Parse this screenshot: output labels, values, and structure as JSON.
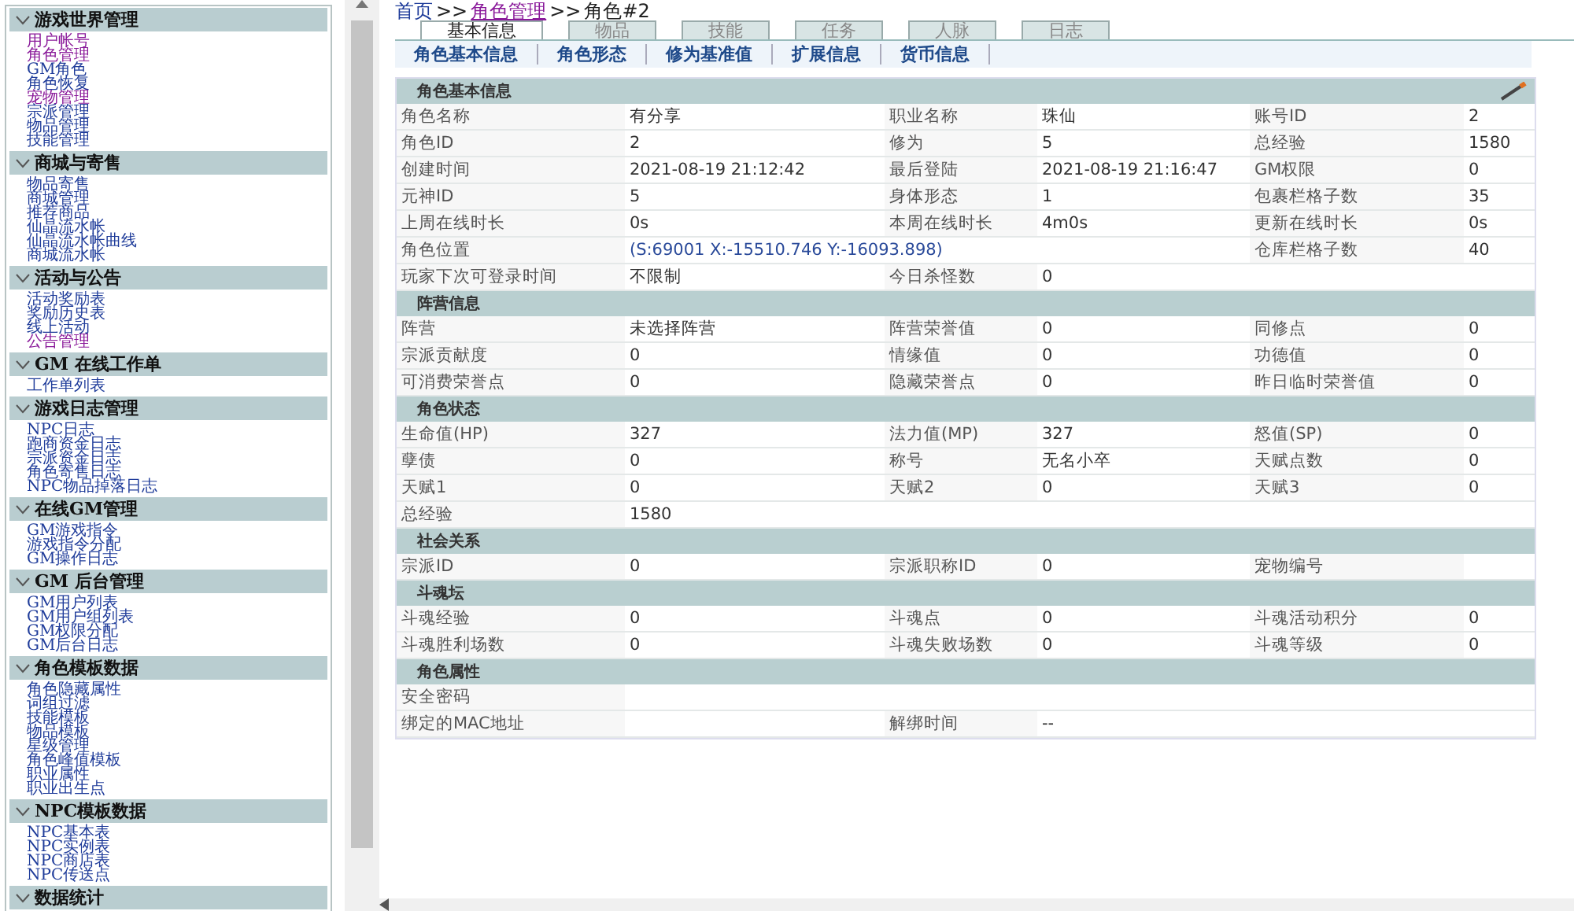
{
  "sidebar": {
    "sections": [
      {
        "title": "游戏世界管理",
        "items": [
          {
            "label": "用户帐号",
            "visited": true
          },
          {
            "label": "角色管理",
            "visited": true
          },
          {
            "label": "GM角色",
            "visited": false
          },
          {
            "label": "角色恢复",
            "visited": false
          },
          {
            "label": "宠物管理",
            "visited": true
          },
          {
            "label": "宗派管理",
            "visited": false
          },
          {
            "label": "物品管理",
            "visited": false
          },
          {
            "label": "技能管理",
            "visited": false
          }
        ]
      },
      {
        "title": "商城与寄售",
        "items": [
          {
            "label": "物品寄售",
            "visited": false
          },
          {
            "label": "商城管理",
            "visited": false
          },
          {
            "label": "推荐商品",
            "visited": false
          },
          {
            "label": "仙晶流水帐",
            "visited": false
          },
          {
            "label": "仙晶流水帐曲线",
            "visited": false
          },
          {
            "label": "商城流水帐",
            "visited": false
          }
        ]
      },
      {
        "title": "活动与公告",
        "items": [
          {
            "label": "活动奖励表",
            "visited": false
          },
          {
            "label": "奖励历史表",
            "visited": false
          },
          {
            "label": "线上活动",
            "visited": false
          },
          {
            "label": "公告管理",
            "visited": true
          }
        ]
      },
      {
        "title": "GM 在线工作单",
        "items": [
          {
            "label": "工作单列表",
            "visited": false
          }
        ]
      },
      {
        "title": "游戏日志管理",
        "items": [
          {
            "label": "NPC日志",
            "visited": false
          },
          {
            "label": "跑商资金日志",
            "visited": false
          },
          {
            "label": "宗派资金日志",
            "visited": false
          },
          {
            "label": "角色寄售日志",
            "visited": false
          },
          {
            "label": "NPC物品掉落日志",
            "visited": false
          }
        ]
      },
      {
        "title": "在线GM管理",
        "items": [
          {
            "label": "GM游戏指令",
            "visited": false
          },
          {
            "label": "游戏指令分配",
            "visited": false
          },
          {
            "label": "GM操作日志",
            "visited": false
          }
        ]
      },
      {
        "title": "GM 后台管理",
        "items": [
          {
            "label": "GM用户列表",
            "visited": false
          },
          {
            "label": "GM用户组列表",
            "visited": false
          },
          {
            "label": "GM权限分配",
            "visited": false
          },
          {
            "label": "GM后台日志",
            "visited": false
          }
        ]
      },
      {
        "title": "角色模板数据",
        "items": [
          {
            "label": "角色隐藏属性",
            "visited": false
          },
          {
            "label": "词组过滤",
            "visited": false
          },
          {
            "label": "技能模板",
            "visited": false
          },
          {
            "label": "物品模板",
            "visited": false
          },
          {
            "label": "星级管理",
            "visited": false
          },
          {
            "label": "角色峰值模板",
            "visited": false
          },
          {
            "label": "职业属性",
            "visited": false
          },
          {
            "label": "职业出生点",
            "visited": false
          }
        ]
      },
      {
        "title": "NPC模板数据",
        "items": [
          {
            "label": "NPC基本表",
            "visited": false
          },
          {
            "label": "NPC实例表",
            "visited": false
          },
          {
            "label": "NPC商店表",
            "visited": false
          },
          {
            "label": "NPC传送点",
            "visited": false
          }
        ]
      },
      {
        "title": "数据统计"
      }
    ]
  },
  "breadcrumb": [
    {
      "label": "首页",
      "kind": "link"
    },
    {
      "label": ">>",
      "kind": "sep"
    },
    {
      "label": "角色管理",
      "kind": "visited"
    },
    {
      "label": ">>",
      "kind": "sep"
    },
    {
      "label": "角色#2",
      "kind": "text"
    }
  ],
  "tabs": [
    {
      "label": "基本信息",
      "selected": true
    },
    {
      "label": "物品",
      "selected": false
    },
    {
      "label": "技能",
      "selected": false
    },
    {
      "label": "任务",
      "selected": false
    },
    {
      "label": "人脉",
      "selected": false
    },
    {
      "label": "日志",
      "selected": false
    }
  ],
  "subtabs": [
    "角色基本信息",
    "角色形态",
    "修为基准值",
    "扩展信息",
    "货币信息"
  ],
  "sections": [
    {
      "title": "角色基本信息",
      "editable": true,
      "rows": [
        {
          "cells": [
            "角色名称",
            "有分享",
            "职业名称",
            "珠仙",
            "账号ID",
            "2"
          ]
        },
        {
          "cells": [
            "角色ID",
            "2",
            "修为",
            "5",
            "总经验",
            "1580"
          ]
        },
        {
          "cells": [
            "创建时间",
            "2021-08-19 21:12:42",
            "最后登陆",
            "2021-08-19 21:16:47",
            "GM权限",
            "0"
          ]
        },
        {
          "cells": [
            "元神ID",
            "5",
            "身体形态",
            "1",
            "包裹栏格子数",
            "35"
          ]
        },
        {
          "cells": [
            "上周在线时长",
            "0s",
            "本周在线时长",
            "4m0s",
            "更新在线时长",
            "0s"
          ]
        },
        {
          "cells": [
            "角色位置",
            "(S:69001  X:-15510.746  Y:-16093.898)",
            "",
            "",
            "仓库栏格子数",
            "40"
          ],
          "coords": true
        },
        {
          "cells": [
            "玩家下次可登录时间",
            "不限制",
            "今日杀怪数",
            "0"
          ]
        }
      ]
    },
    {
      "title": "阵营信息",
      "editable": false,
      "rows": [
        {
          "cells": [
            "阵营",
            "未选择阵营",
            "阵营荣誉值",
            "0",
            "同修点",
            "0"
          ]
        },
        {
          "cells": [
            "宗派贡献度",
            "0",
            "情缘值",
            "0",
            "功德值",
            "0"
          ]
        },
        {
          "cells": [
            "可消费荣誉点",
            "0",
            "隐藏荣誉点",
            "0",
            "昨日临时荣誉值",
            "0"
          ]
        }
      ]
    },
    {
      "title": "角色状态",
      "editable": false,
      "rows": [
        {
          "cells": [
            "生命值(HP)",
            "327",
            "法力值(MP)",
            "327",
            "怒值(SP)",
            "0"
          ]
        },
        {
          "cells": [
            "孽债",
            "0",
            "称号",
            "无名小卒",
            "天赋点数",
            "0"
          ]
        },
        {
          "cells": [
            "天赋1",
            "0",
            "天赋2",
            "0",
            "天赋3",
            "0"
          ]
        },
        {
          "cells": [
            "总经验",
            "1580"
          ]
        }
      ]
    },
    {
      "title": "社会关系",
      "editable": false,
      "rows": [
        {
          "cells": [
            "宗派ID",
            "0",
            "宗派职称ID",
            "0",
            "宠物编号"
          ]
        }
      ]
    },
    {
      "title": "斗魂坛",
      "editable": false,
      "rows": [
        {
          "cells": [
            "斗魂经验",
            "0",
            "斗魂点",
            "0",
            "斗魂活动积分",
            "0"
          ]
        },
        {
          "cells": [
            "斗魂胜利场数",
            "0",
            "斗魂失败场数",
            "0",
            "斗魂等级",
            "0"
          ]
        }
      ]
    },
    {
      "title": "角色属性",
      "editable": false,
      "rows": [
        {
          "cells": [
            "安全密码"
          ]
        },
        {
          "cells": [
            "绑定的MAC地址",
            "",
            "解绑时间",
            "--"
          ]
        }
      ]
    }
  ]
}
